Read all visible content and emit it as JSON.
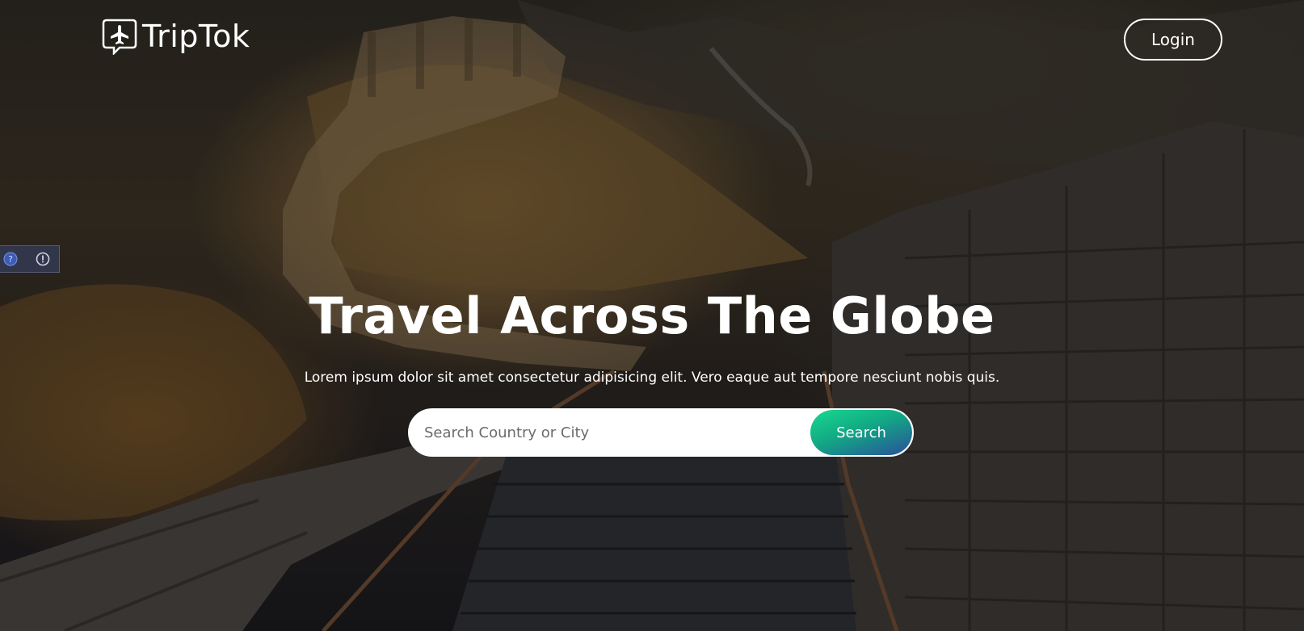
{
  "header": {
    "logo_text": "TripTok",
    "logo_icon": "airplane-chat-icon",
    "login_label": "Login"
  },
  "hero": {
    "title": "Travel Across The Globe",
    "subtitle": "Lorem ipsum dolor sit amet consectetur adipisicing elit. Vero eaque aut tempore nesciunt nobis quis."
  },
  "search": {
    "placeholder": "Search Country or City",
    "value": "",
    "button_label": "Search"
  },
  "side_widget": {
    "icons": [
      "help-icon",
      "info-icon"
    ]
  },
  "colors": {
    "search_button_from": "#17d98f",
    "search_button_to": "#2a4f9c",
    "side_widget": "#343a52"
  }
}
